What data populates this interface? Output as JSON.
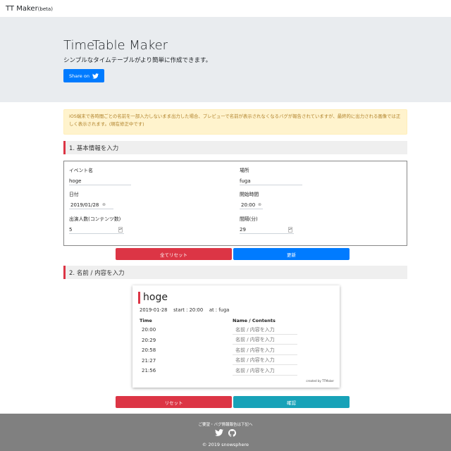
{
  "navbar": {
    "brand": "TT Maker",
    "brand_suffix": "(beta)"
  },
  "hero": {
    "title": "TimeTable Maker",
    "subtitle": "シンプルなタイムテーブルがより簡単に作成できます。",
    "share_label": "Share on"
  },
  "alert": {
    "text": "iOS端末で各時間ごとの名前を一部入力しないまま出力した場合、プレビューで名前が表示されなくなるバグが報告されていますが、最終的に出力される画像では正しく表示されます。(現在修正中です)"
  },
  "section1": {
    "heading": "1. 基本情報を入力"
  },
  "form": {
    "event_label": "イベント名",
    "event_value": "hoge",
    "place_label": "場所",
    "place_value": "fuga",
    "date_label": "日付",
    "date_value": "2019/01/28",
    "start_label": "開始時間",
    "start_value": "20:00",
    "performers_label": "出演人数(コンテンツ数)",
    "performers_value": "5",
    "interval_label": "間隔(分)",
    "interval_value": "29"
  },
  "buttons": {
    "reset_all": "全てリセット",
    "update": "更新",
    "reset": "リセット",
    "confirm": "確認"
  },
  "section2": {
    "heading": "2. 名前 / 内容を入力"
  },
  "preview": {
    "title": "hoge",
    "meta": "2019-01-28    start : 20:00    at : fuga",
    "col_time": "Time",
    "col_name": "Name / Contents",
    "name_placeholder": "名前 / 内容を入力",
    "rows": [
      {
        "time": "20:00"
      },
      {
        "time": "20:29"
      },
      {
        "time": "20:58"
      },
      {
        "time": "21:27"
      },
      {
        "time": "21:56"
      }
    ],
    "credit": "created by TTMaker"
  },
  "footer": {
    "note": "ご要望・バグ情報報告は下記へ",
    "copyright": "© 2019 snowsphere"
  },
  "colors": {
    "primary": "#007bff",
    "danger": "#dc3545",
    "info": "#17a2b8",
    "footer": "#808080",
    "hero": "#e9ecef"
  },
  "icons": [
    "twitter-icon",
    "github-icon",
    "calendar-icon",
    "clock-icon"
  ]
}
